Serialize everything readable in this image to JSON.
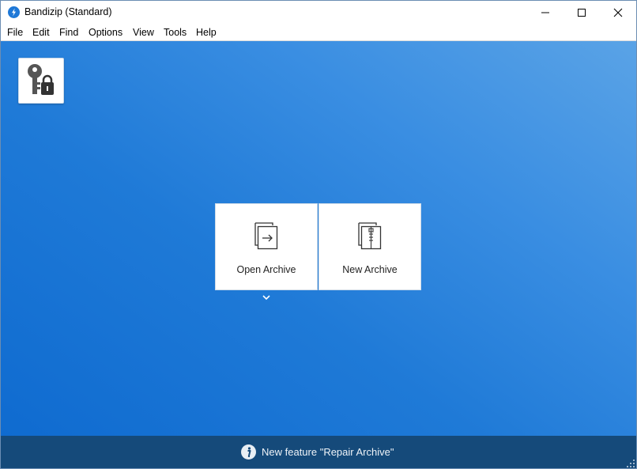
{
  "window": {
    "title": "Bandizip (Standard)"
  },
  "menu": {
    "items": [
      "File",
      "Edit",
      "Find",
      "Options",
      "View",
      "Tools",
      "Help"
    ]
  },
  "tiles": {
    "open_label": "Open Archive",
    "new_label": "New Archive"
  },
  "status": {
    "text": "New feature \"Repair Archive\""
  },
  "icons": {
    "app": "bandizip-logo-icon",
    "key_lock": "key-lock-icon",
    "open": "open-archive-icon",
    "new": "new-archive-icon",
    "info": "info-icon"
  },
  "colors": {
    "accent": "#1e78d7",
    "background_top": "#5aa3e6",
    "background_bottom": "#0f6bd0",
    "statusbar": "#154a7a"
  }
}
